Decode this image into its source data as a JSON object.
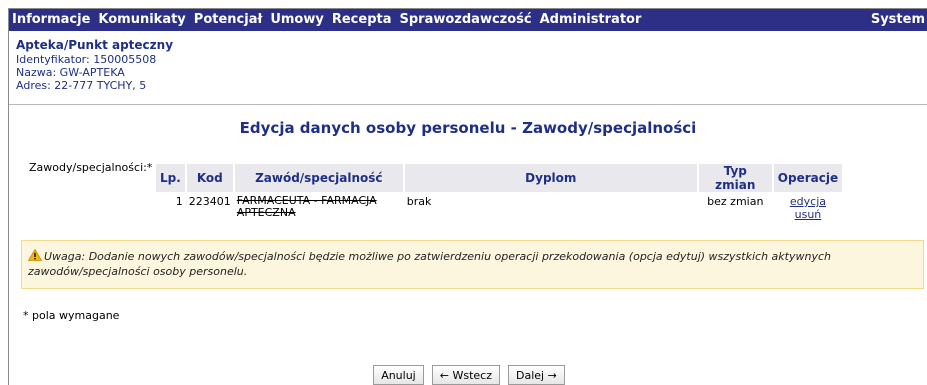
{
  "menu": {
    "items": [
      "Informacje",
      "Komunikaty",
      "Potencjał",
      "Umowy",
      "Recepta",
      "Sprawozdawczość",
      "Administrator"
    ],
    "right": "System"
  },
  "info": {
    "title": "Apteka/Punkt apteczny",
    "identifier": "Identyfikator: 150005508",
    "name": "Nazwa: GW-APTEKA",
    "address": "Adres: 22-777 TYCHY, 5"
  },
  "heading": "Edycja danych osoby personelu - Zawody/specjalności",
  "field_label": "Zawody/specjalności:*",
  "table": {
    "headers": [
      "Lp.",
      "Kod",
      "Zawód/specjalność",
      "Dyplom",
      "Typ zmian",
      "Operacje"
    ],
    "rows": [
      {
        "lp": "1",
        "kod": "223401",
        "zawod": "FARMACEUTA - FARMACJA APTECZNA",
        "dyplom": "brak",
        "typ": "bez zmian",
        "op_edit": "edycja",
        "op_delete": "usuń"
      }
    ]
  },
  "warning": {
    "icon": "warning-triangle-icon",
    "text": "Uwaga: Dodanie nowych zawodów/specjalności będzie możliwe po zatwierdzeniu operacji przekodowania (opcja edytuj) wszystkich aktywnych zawodów/specjalności osoby personelu."
  },
  "required_note": "* pola wymagane",
  "buttons": {
    "cancel": "Anuluj",
    "back": "← Wstecz",
    "next": "Dalej →"
  },
  "colors": {
    "menubar": "#2d2f86",
    "text_blue": "#1f2f86",
    "warning_bg": "#fdf6de",
    "warning_border": "#f2d98c"
  }
}
